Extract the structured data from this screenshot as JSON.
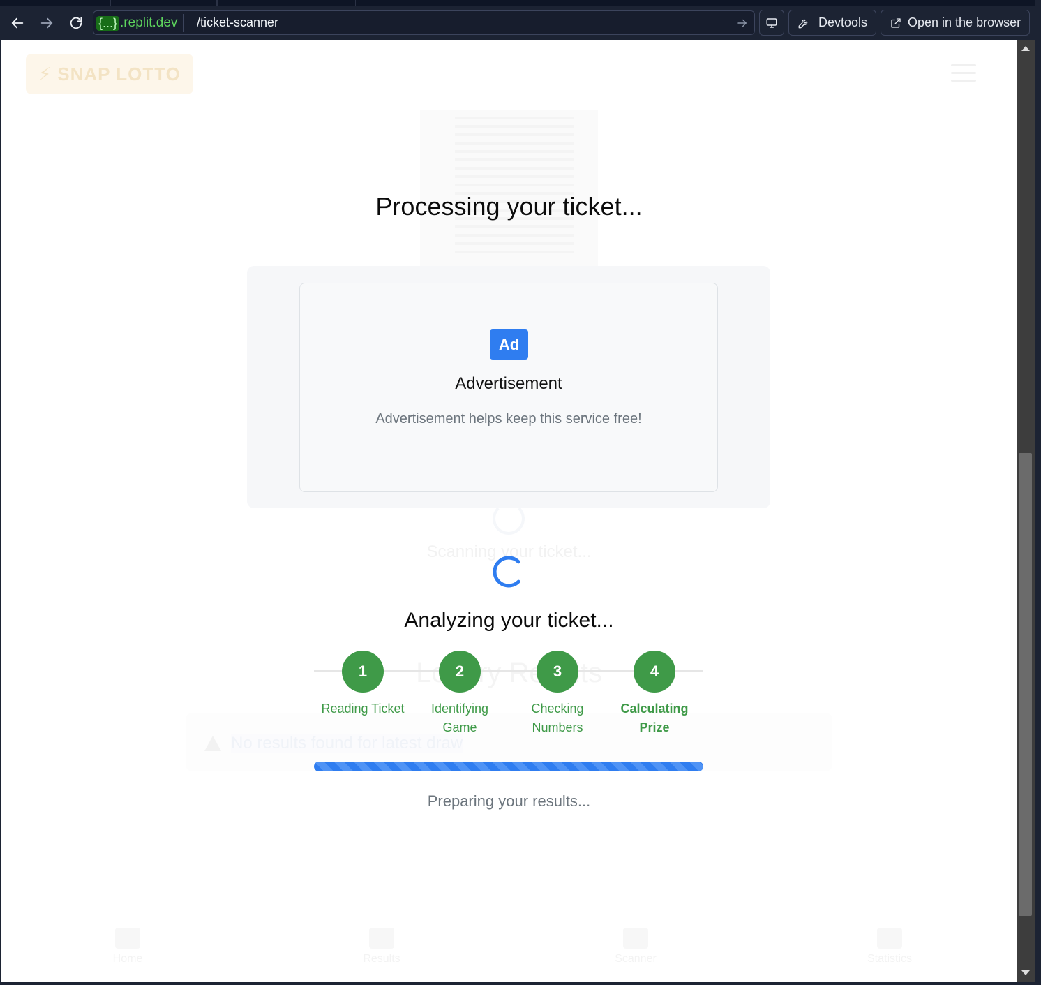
{
  "browser": {
    "url_host_brace": "{...}",
    "url_host_domain": ".replit.dev",
    "url_path": "/ticket-scanner",
    "devtools_label": "Devtools",
    "open_browser_label": "Open in the browser"
  },
  "background": {
    "logo_text": "SNAP LOTTO",
    "scanning_text": "Scanning your ticket...",
    "results_title": "Lottery Results",
    "alert_text": "No results found for latest draw",
    "bottom_nav": [
      "Home",
      "Results",
      "Scanner",
      "Statistics"
    ]
  },
  "overlay": {
    "processing_title": "Processing your ticket...",
    "ad": {
      "badge": "Ad",
      "title": "Advertisement",
      "description": "Advertisement helps keep this service free!"
    },
    "analyzing_title": "Analyzing your ticket...",
    "steps": [
      {
        "number": "1",
        "label": "Reading Ticket"
      },
      {
        "number": "2",
        "label": "Identifying Game"
      },
      {
        "number": "3",
        "label": "Checking Numbers"
      },
      {
        "number": "4",
        "label": "Calculating Prize"
      }
    ],
    "progress_fraction": 1.0,
    "status_text": "Preparing your results..."
  },
  "colors": {
    "accent_blue": "#2f7df0",
    "step_green": "#3f9a48",
    "muted_text": "#6c757d"
  }
}
